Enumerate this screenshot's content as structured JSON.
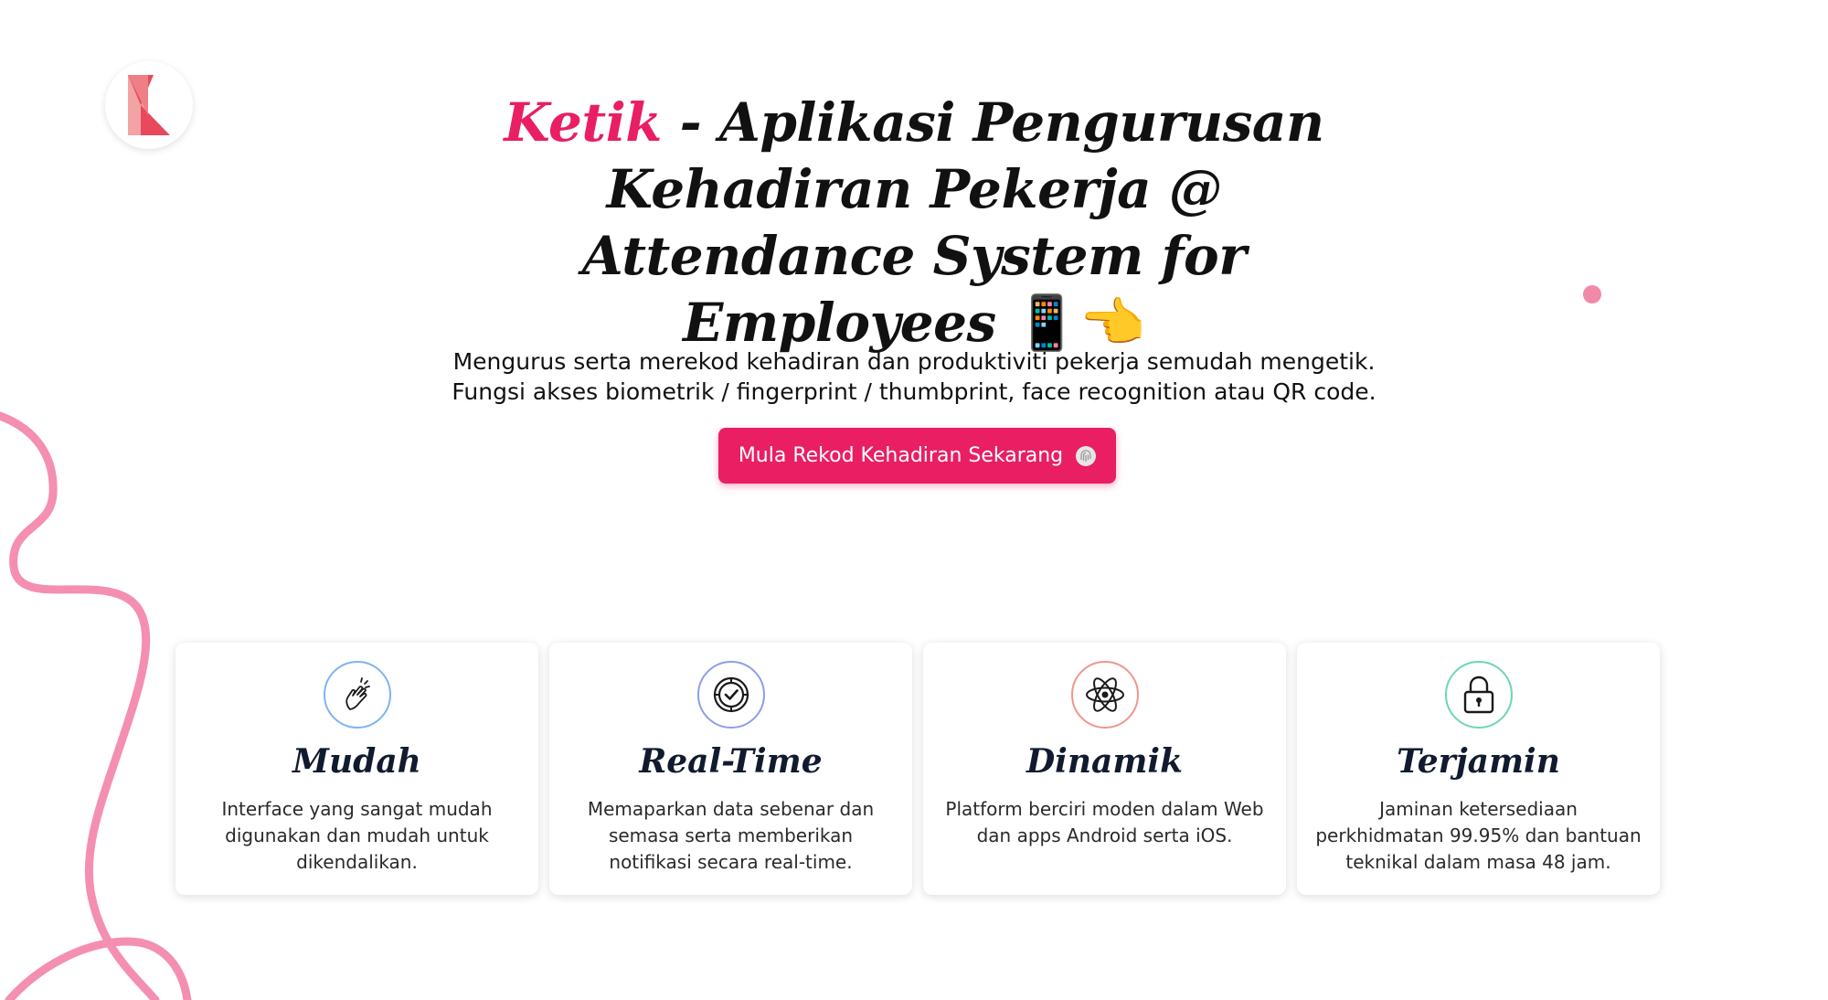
{
  "logo": {
    "icon": "ketik-k-logo-icon",
    "colors": [
      "#e8495d",
      "#f2a3a3"
    ]
  },
  "hero": {
    "title_brand": "Ketik",
    "title_rest": " - Aplikasi Pengurusan Kehadiran Pekerja @ Attendance System for Employees",
    "title_emoji": "📱👈",
    "subtitle": "Mengurus serta merekod kehadiran dan produktiviti pekerja semudah mengetik. Fungsi akses biometrik / fingerprint / thumbprint, face recognition atau QR code.",
    "cta_label": "Mula Rekod Kehadiran Sekarang",
    "cta_icon": "fingerprint-icon"
  },
  "features": [
    {
      "title": "Mudah",
      "desc": "Interface yang sangat mudah digunakan dan mudah untuk dikendalikan.",
      "icon": "snap-fingers-icon",
      "ring_color": "#7fb3f0"
    },
    {
      "title": "Real-Time",
      "desc": "Memaparkan data sebenar dan semasa serta memberikan notifikasi secara real-time.",
      "icon": "clock-check-icon",
      "ring_color": "#8e9ee8"
    },
    {
      "title": "Dinamik",
      "desc": "Platform berciri moden dalam Web dan apps Android serta iOS.",
      "icon": "atom-icon",
      "ring_color": "#f0968e"
    },
    {
      "title": "Terjamin",
      "desc": "Jaminan ketersediaan perkhidmatan 99.95% dan bantuan teknikal dalam masa 48 jam.",
      "icon": "padlock-icon",
      "ring_color": "#6fd6b0"
    }
  ],
  "colors": {
    "brand": "#e91e63",
    "squiggle": "#f48fb1",
    "dot": "#f08aa8"
  }
}
